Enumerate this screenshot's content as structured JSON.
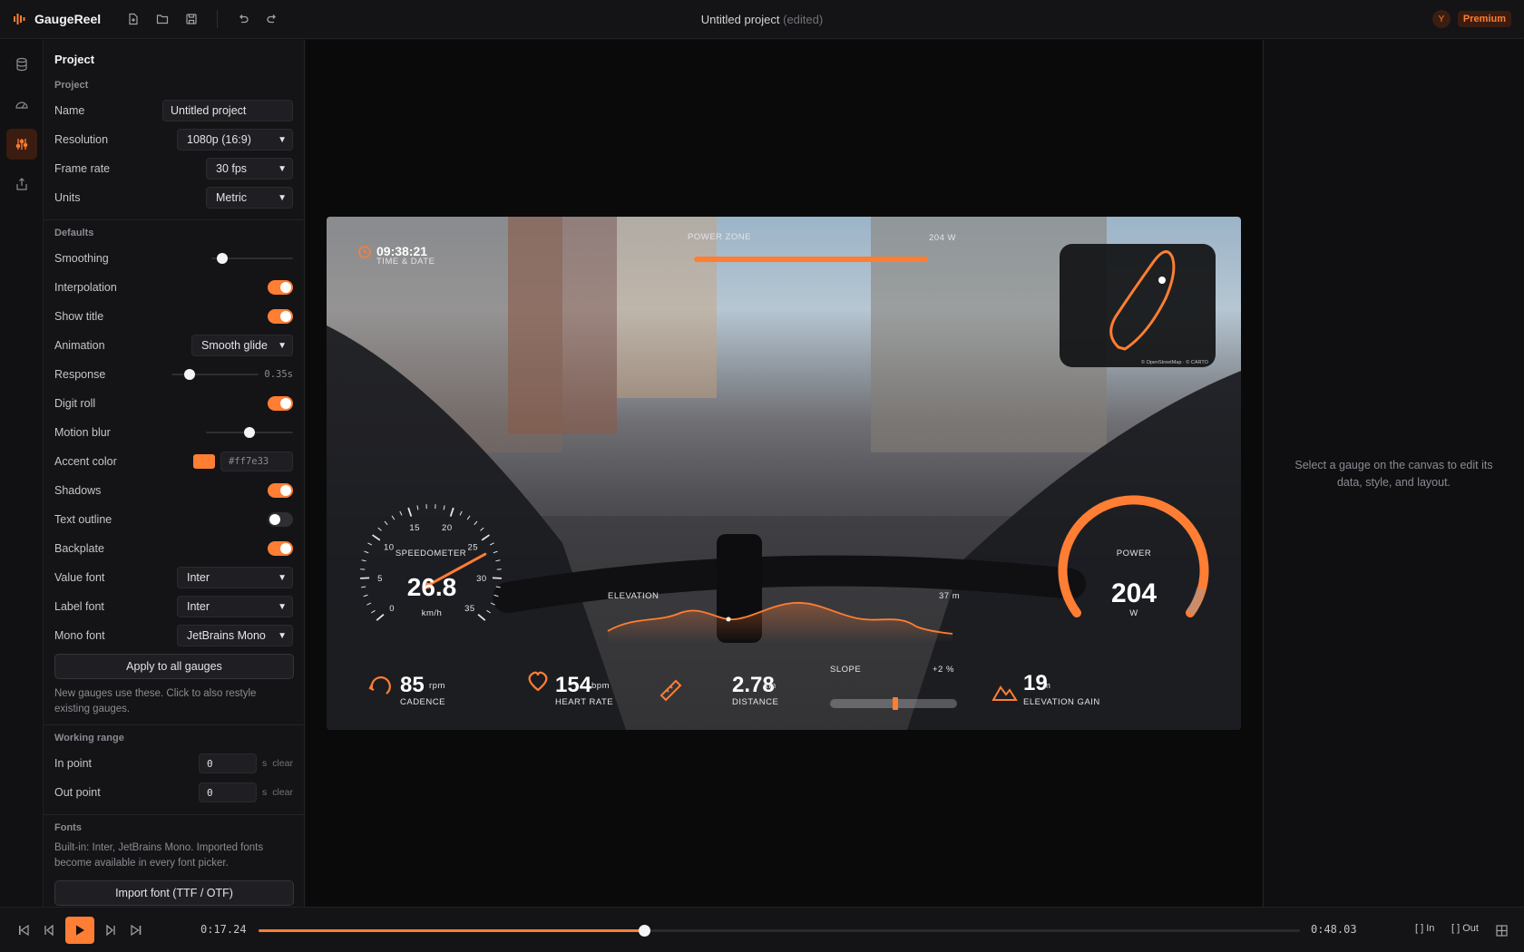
{
  "app": {
    "name": "GaugeReel",
    "title": "Untitled project",
    "title_suffix": "(edited)",
    "accent": "#ff7e33"
  },
  "user": {
    "initial": "Y",
    "plan": "Premium"
  },
  "toolbar": {
    "icons": [
      "new-file-icon",
      "open-folder-icon",
      "save-icon",
      "undo-icon",
      "redo-icon"
    ]
  },
  "rail": {
    "icons": [
      "data-icon",
      "gauges-icon",
      "settings-icon",
      "export-icon"
    ],
    "active": "settings-icon"
  },
  "panel": {
    "title": "Project",
    "project": {
      "heading": "Project",
      "name_label": "Name",
      "name_value": "Untitled project",
      "resolution_label": "Resolution",
      "resolution_value": "1080p (16:9)",
      "framerate_label": "Frame rate",
      "framerate_value": "30 fps",
      "units_label": "Units",
      "units_value": "Metric"
    },
    "defaults": {
      "heading": "Defaults",
      "smoothing_label": "Smoothing",
      "smoothing_level": 0.1,
      "interpolation_label": "Interpolation",
      "interpolation_on": true,
      "show_title_label": "Show title",
      "show_title_on": true,
      "animation_label": "Animation",
      "animation_value": "Smooth glide",
      "response_label": "Response",
      "response_value": "0.35s",
      "response_level": 0.2,
      "digit_roll_label": "Digit roll",
      "digit_roll_on": true,
      "motion_blur_label": "Motion blur",
      "motion_blur_level": 0.5,
      "accent_label": "Accent color",
      "accent_value": "#ff7e33",
      "shadows_label": "Shadows",
      "shadows_on": true,
      "text_outline_label": "Text outline",
      "text_outline_on": false,
      "backplate_label": "Backplate",
      "backplate_on": true,
      "value_font_label": "Value font",
      "value_font_value": "Inter",
      "label_font_label": "Label font",
      "label_font_value": "Inter",
      "mono_font_label": "Mono font",
      "mono_font_value": "JetBrains Mono",
      "apply_button": "Apply to all gauges",
      "help": "New gauges use these. Click to also restyle existing gauges."
    },
    "working_range": {
      "heading": "Working range",
      "in_label": "In point",
      "in_value": "0",
      "out_label": "Out point",
      "out_value": "0",
      "unit": "s",
      "clear": "clear"
    },
    "fonts": {
      "heading": "Fonts",
      "help": "Built-in: Inter, JetBrains Mono. Imported fonts become available in every font picker.",
      "import_button": "Import font (TTF / OTF)"
    }
  },
  "overlay": {
    "clock": {
      "value": "09:38:21",
      "label": "TIME & DATE"
    },
    "map": {
      "credit": "© OpenStreetMap · © CARTO"
    },
    "power_bar": {
      "left_label": "POWER ZONE",
      "right_label": "204 W"
    },
    "speedometer": {
      "label": "SPEEDOMETER",
      "value": "26.8",
      "unit": "km/h",
      "ticks": [
        "0",
        "5",
        "10",
        "15",
        "20",
        "25",
        "30",
        "35"
      ],
      "max": 35,
      "reading": 26.8
    },
    "elevation": {
      "label": "ELEVATION",
      "value": "37 m"
    },
    "power": {
      "label": "POWER",
      "value": "204",
      "unit": "W"
    },
    "cadence": {
      "value": "85",
      "unit": "rpm",
      "label": "CADENCE"
    },
    "heart_rate": {
      "value": "154",
      "unit": "bpm",
      "label": "HEART RATE"
    },
    "distance": {
      "value": "2.78",
      "unit": "km",
      "label": "DISTANCE"
    },
    "slope": {
      "label": "SLOPE",
      "value": "+2 %"
    },
    "elevation_gain": {
      "value": "19",
      "unit": "m",
      "label": "ELEVATION GAIN"
    }
  },
  "inspector": {
    "hint": "Select a gauge on the canvas to edit its data, style, and layout."
  },
  "timeline": {
    "current": "0:17.24",
    "total": "0:48.03",
    "progress": 0.37,
    "in_label": "In",
    "out_label": "Out"
  }
}
